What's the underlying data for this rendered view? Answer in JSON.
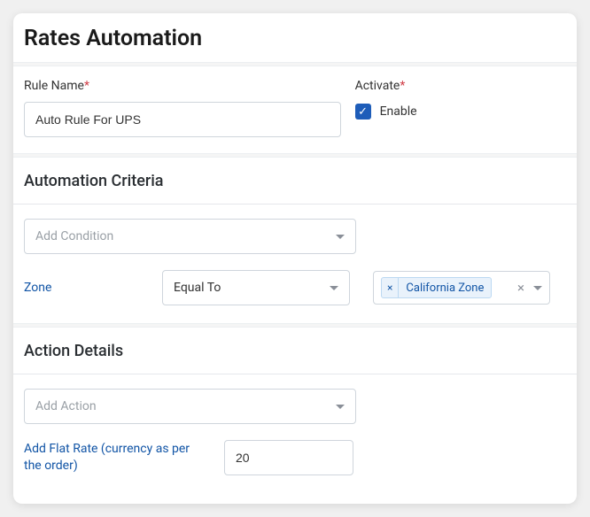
{
  "title": "Rates Automation",
  "ruleName": {
    "label": "Rule Name",
    "value": "Auto Rule For UPS"
  },
  "activate": {
    "label": "Activate",
    "checkboxLabel": "Enable",
    "checked": true
  },
  "criteria": {
    "header": "Automation Criteria",
    "addConditionPlaceholder": "Add Condition",
    "row": {
      "field": "Zone",
      "operator": "Equal To",
      "tag": "California Zone"
    }
  },
  "action": {
    "header": "Action Details",
    "addActionPlaceholder": "Add Action",
    "row": {
      "label": "Add Flat Rate (currency as per the order)",
      "value": "20"
    }
  }
}
